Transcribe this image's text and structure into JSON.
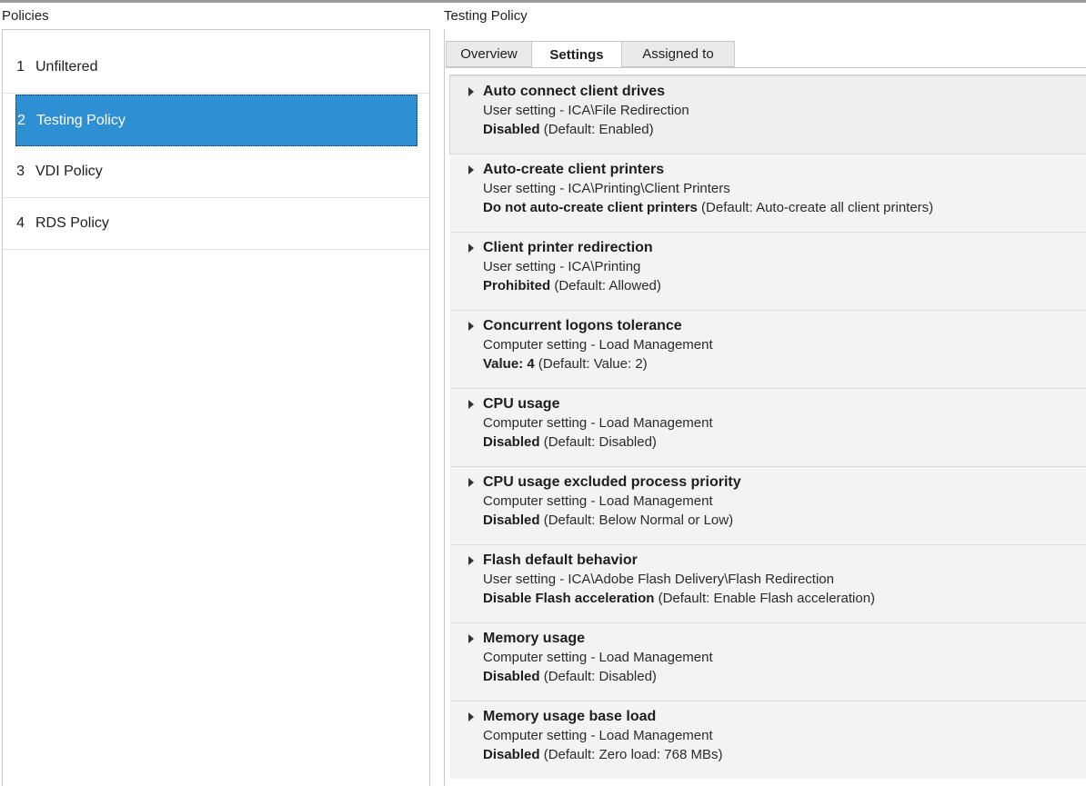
{
  "left_panel": {
    "header": "Policies",
    "items": [
      {
        "num": "1",
        "label": "Unfiltered"
      },
      {
        "num": "2",
        "label": "Testing Policy"
      },
      {
        "num": "3",
        "label": "VDI Policy"
      },
      {
        "num": "4",
        "label": "RDS Policy"
      }
    ],
    "selected_index": 1
  },
  "right_panel": {
    "header": "Testing Policy",
    "tabs": [
      {
        "label": "Overview"
      },
      {
        "label": "Settings"
      },
      {
        "label": "Assigned to"
      }
    ],
    "active_tab": "Settings",
    "settings": [
      {
        "title": "Auto connect client drives",
        "scope": "User setting - ICA\\File Redirection",
        "value": "Disabled",
        "default": "(Default: Enabled)"
      },
      {
        "title": "Auto-create client printers",
        "scope": "User setting - ICA\\Printing\\Client Printers",
        "value": "Do not auto-create client printers",
        "default": "(Default: Auto-create all client printers)"
      },
      {
        "title": "Client printer redirection",
        "scope": "User setting - ICA\\Printing",
        "value": "Prohibited",
        "default": "(Default: Allowed)"
      },
      {
        "title": "Concurrent logons tolerance",
        "scope": "Computer setting - Load Management",
        "value": "Value: 4",
        "default": "(Default: Value: 2)"
      },
      {
        "title": "CPU usage",
        "scope": "Computer setting - Load Management",
        "value": "Disabled",
        "default": "(Default: Disabled)"
      },
      {
        "title": "CPU usage excluded process priority",
        "scope": "Computer setting - Load Management",
        "value": "Disabled",
        "default": "(Default: Below Normal or Low)"
      },
      {
        "title": "Flash default behavior",
        "scope": "User setting - ICA\\Adobe Flash Delivery\\Flash Redirection",
        "value": "Disable Flash acceleration",
        "default": "(Default: Enable Flash acceleration)"
      },
      {
        "title": "Memory usage",
        "scope": "Computer setting - Load Management",
        "value": "Disabled",
        "default": "(Default: Disabled)"
      },
      {
        "title": "Memory usage base load",
        "scope": "Computer setting - Load Management",
        "value": "Disabled",
        "default": "(Default: Zero load: 768 MBs)"
      }
    ]
  },
  "colors": {
    "selection": "#2f8fd3",
    "row_shade": "#f3f3f3",
    "border": "#c8c8c8"
  }
}
